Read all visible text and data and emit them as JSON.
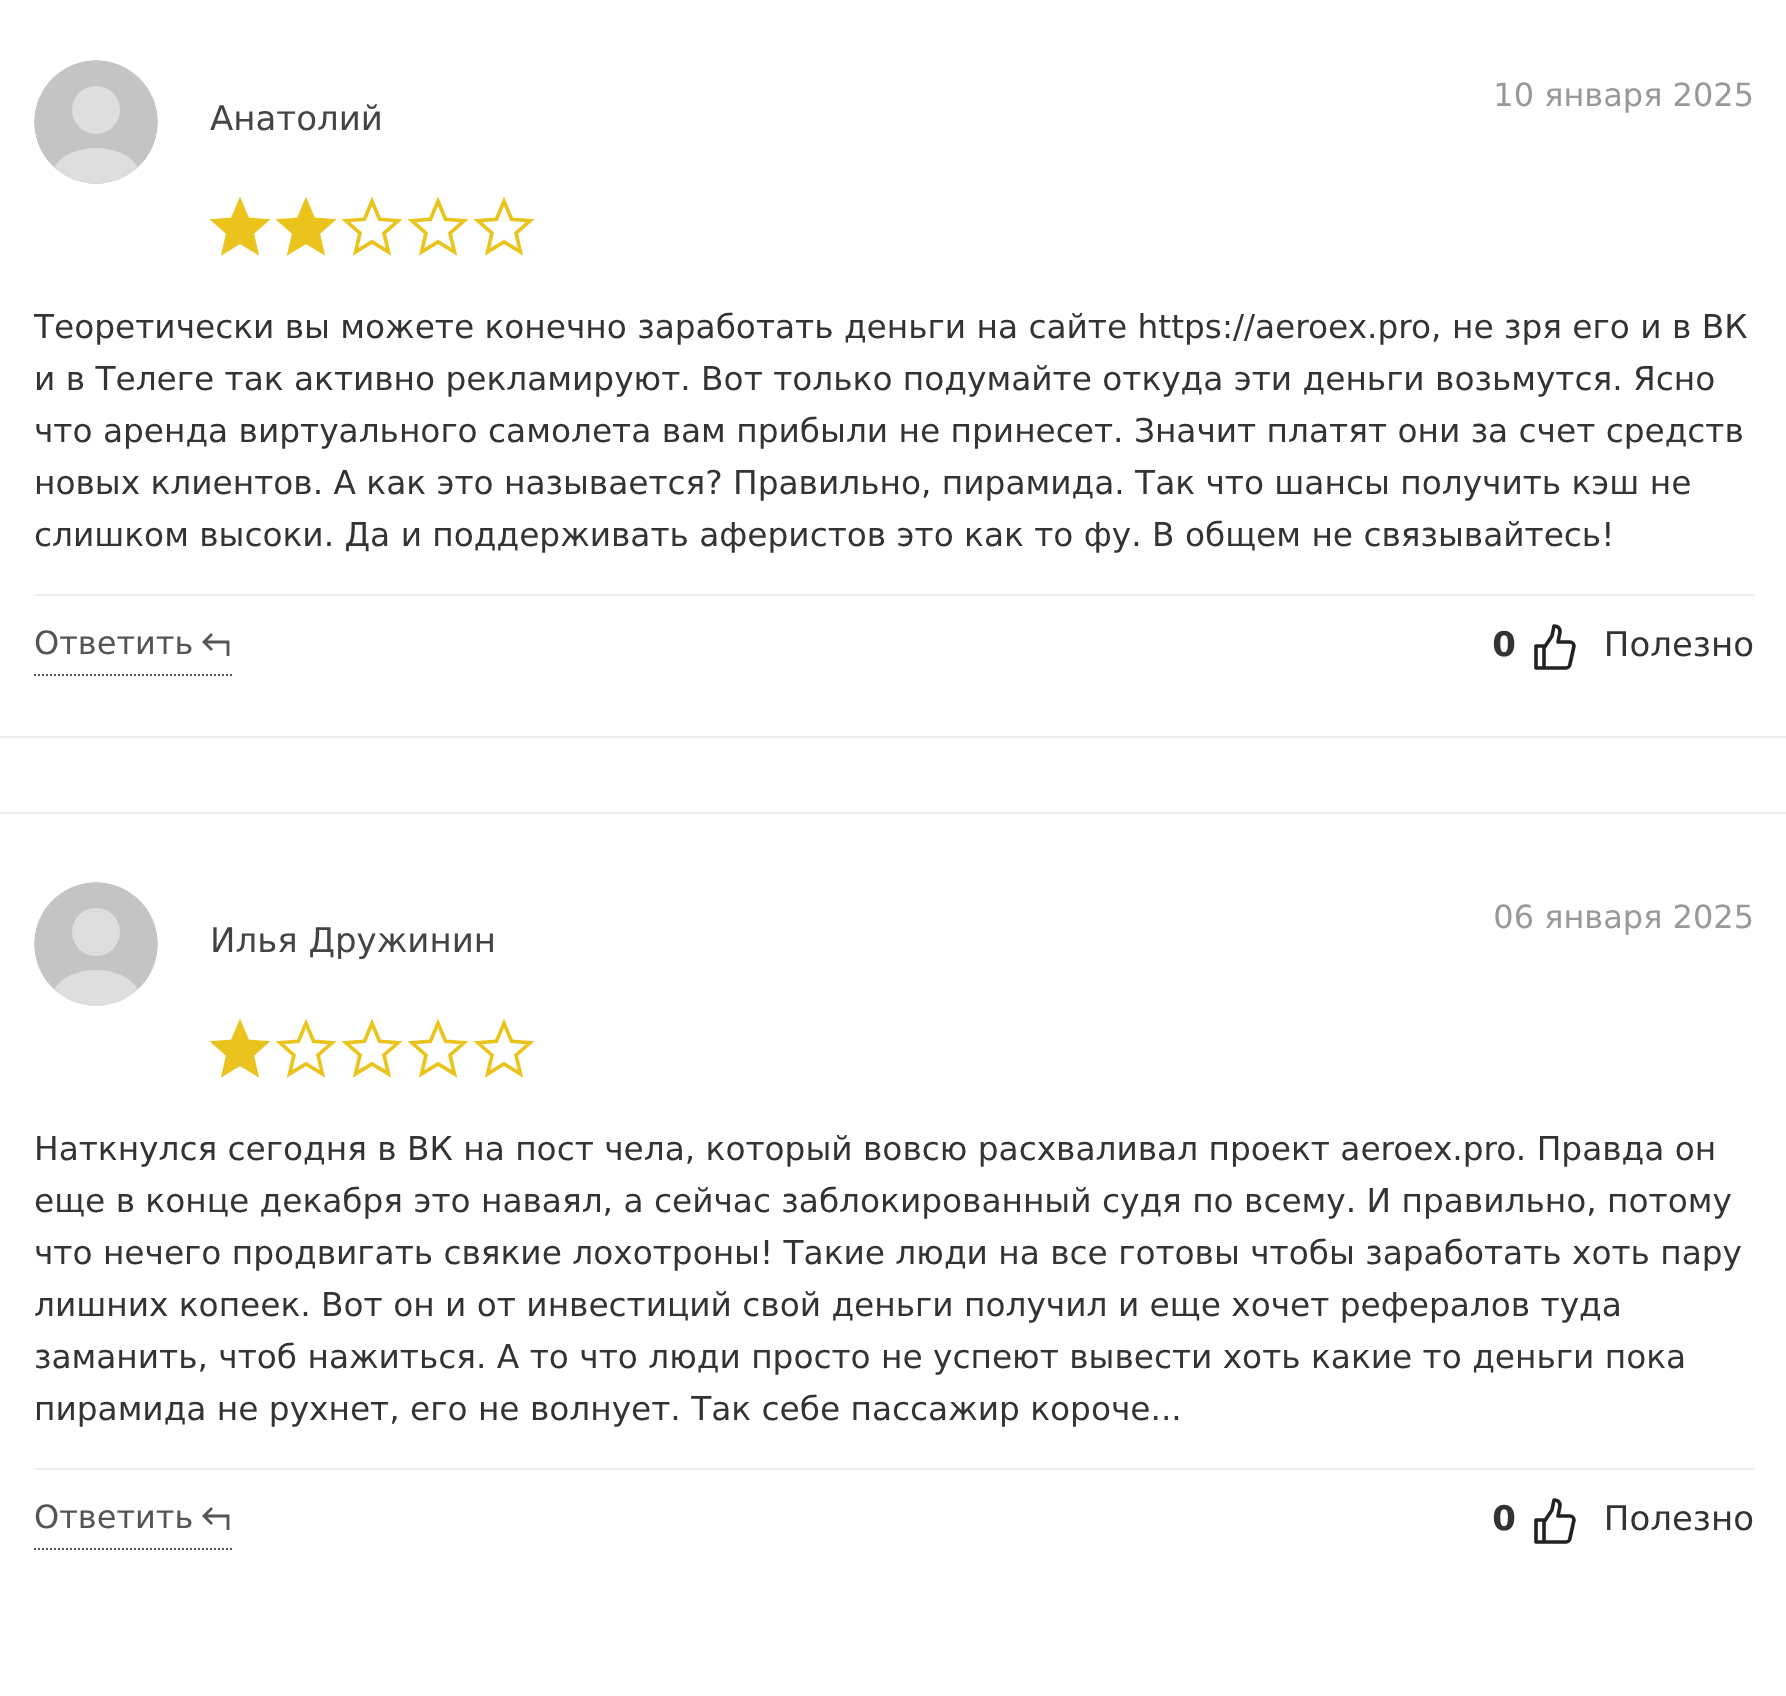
{
  "reviews": [
    {
      "author": "Анатолий",
      "date": "10 января 2025",
      "stars": 2,
      "text": "Теоретически вы можете конечно заработать деньги на сайте https://aeroex.pro, не зря его и в ВК и в Телеге так активно рекламируют. Вот только подумайте откуда эти деньги возьмутся. Ясно что аренда виртуального самолета вам прибыли не принесет. Значит платят они за счет средств новых клиентов. А как это называется? Правильно, пирамида. Так что шансы получить кэш не слишком высоки. Да и поддерживать аферистов это как то фу. В общем не связывайтесь!",
      "reply": "Ответить",
      "likes": "0",
      "helpful": "Полезно"
    },
    {
      "author": "Илья Дружинин",
      "date": "06 января 2025",
      "stars": 1,
      "text": "Наткнулся сегодня в ВК на пост чела, который вовсю расхваливал проект aeroex.pro. Правда он еще в конце декабря это наваял, а сейчас заблокированный судя по всему. И правильно, потому что нечего продвигать свякие лохотроны! Такие люди на все готовы чтобы заработать хоть пару лишних копеек. Вот он и от инвестиций свой деньги получил и еще хочет рефералов туда заманить, чтоб нажиться. А то что люди просто не успеют вывести хоть какие то деньги пока пирамида не рухнет, его не волнует. Так себе пассажир короче...",
      "reply": "Ответить",
      "likes": "0",
      "helpful": "Полезно"
    }
  ]
}
